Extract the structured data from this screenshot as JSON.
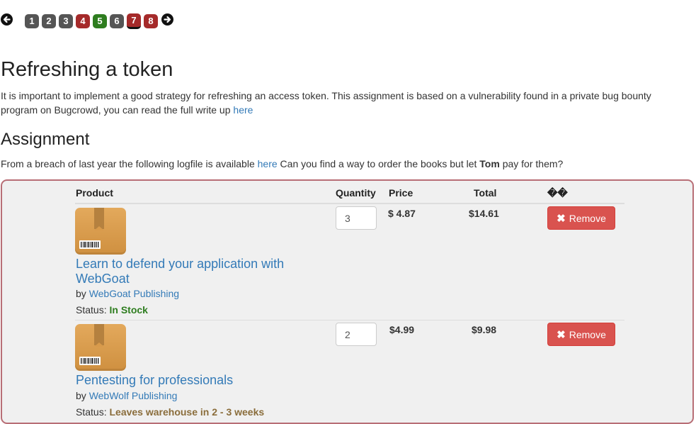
{
  "pager": {
    "prev_icon": "arrow-left-circle-icon",
    "next_icon": "arrow-right-circle-icon",
    "pages": [
      {
        "label": "1",
        "state": "grey"
      },
      {
        "label": "2",
        "state": "grey"
      },
      {
        "label": "3",
        "state": "grey"
      },
      {
        "label": "4",
        "state": "red"
      },
      {
        "label": "5",
        "state": "green"
      },
      {
        "label": "6",
        "state": "grey"
      },
      {
        "label": "7",
        "state": "red-current"
      },
      {
        "label": "8",
        "state": "red"
      }
    ]
  },
  "title": "Refreshing a token",
  "intro": {
    "text": "It is important to implement a good strategy for refreshing an access token. This assignment is based on a vulnerability found in a private bug bounty program on Bugcrowd, you can read the full write up ",
    "link": "here"
  },
  "assignment": {
    "heading": "Assignment",
    "text_before": "From a breach of last year the following logfile is available ",
    "link": "here",
    "text_mid": " Can you find a way to order the books but let ",
    "name": "Tom",
    "text_after": " pay for them?"
  },
  "table": {
    "headers": {
      "product": "Product",
      "quantity": "Quantity",
      "price": "Price",
      "total": "Total",
      "extra": "��"
    },
    "rows": [
      {
        "title": "Learn to defend your application with WebGoat",
        "by_label": "by",
        "publisher": "WebGoat Publishing",
        "status_label": "Status:",
        "status": "In Stock",
        "quantity": "3",
        "price": "$ 4.87",
        "total": "$14.61",
        "remove": "Remove"
      },
      {
        "title": "Pentesting for professionals",
        "by_label": "by",
        "publisher": "WebWolf Publishing",
        "status_label": "Status:",
        "status": "Leaves warehouse in 2 - 3 weeks",
        "quantity": "2",
        "price": "$4.99",
        "total": "$9.98",
        "remove": "Remove"
      }
    ]
  },
  "colors": {
    "link": "#337ab7",
    "in_stock": "#2e7d1f",
    "warn": "#8a6d3b",
    "remove_button": "#d9534f",
    "panel_border": "#b86e76",
    "panel_bg": "#f0f0f0"
  }
}
